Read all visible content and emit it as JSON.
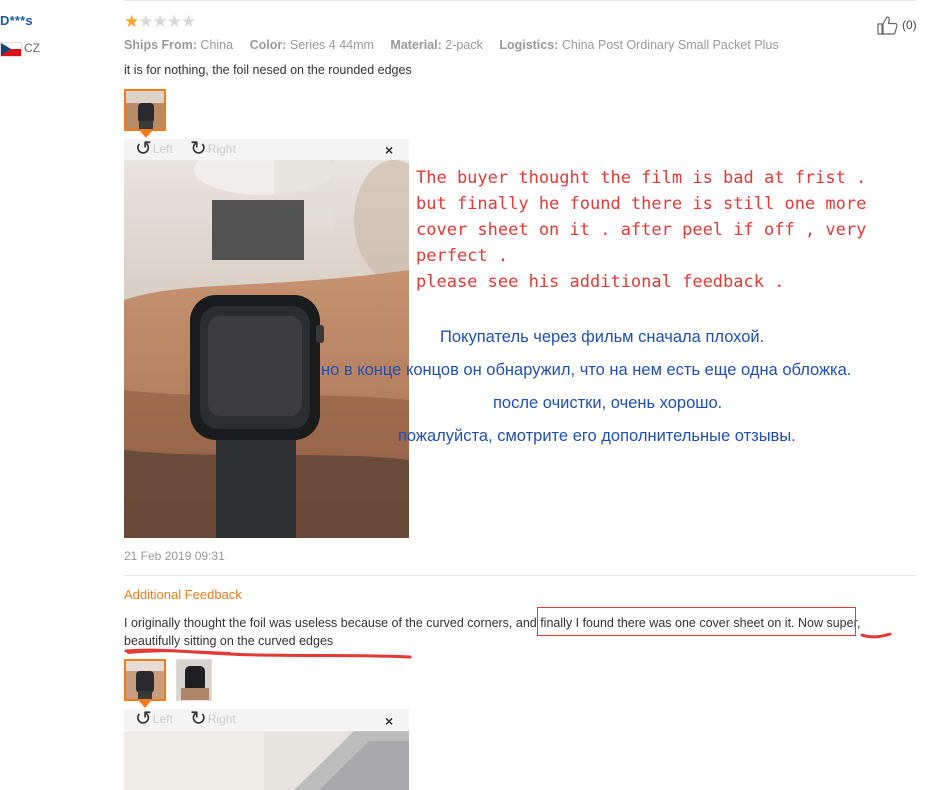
{
  "review": {
    "username": "D***s",
    "country": "CZ",
    "rating": 1,
    "rating_max": 5,
    "likes": "(0)",
    "meta": {
      "ships_from_label": "Ships From:",
      "ships_from_value": "China",
      "color_label": "Color:",
      "color_value": "Series 4 44mm",
      "material_label": "Material:",
      "material_value": "2-pack",
      "logistics_label": "Logistics:",
      "logistics_value": "China Post Ordinary Small Packet Plus"
    },
    "text": "it is for nothing, the foil nesed on the rounded edges",
    "date": "21 Feb 2019 09:31"
  },
  "viewer": {
    "left_label": "Left",
    "right_label": "Right",
    "close_label": "×"
  },
  "annotation": {
    "en": "The buyer thought the film is bad at frist .\nbut finally he found there is still one more\ncover sheet on it . after peel if off , very\nperfect .\nplease see his additional feedback .",
    "ru_line1": "Покупатель через фильм сначала плохой.",
    "ru_line2": "но в конце концов он обнаружил, что на нем есть еще одна обложка.",
    "ru_line3": "после очистки, очень хорошо.",
    "ru_line4": "пожалуйста, смотрите его дополнительные отзывы."
  },
  "additional": {
    "title": "Additional Feedback",
    "text": "I originally thought the foil was useless because of the curved corners, and finally I found there was one cover sheet on it. Now super, beautifully sitting on the curved edges"
  },
  "colors": {
    "accent_orange": "#f07c1c",
    "annotation_red": "#e53935",
    "annotation_blue": "#1f4fb4",
    "username_blue": "#1f5aa8"
  }
}
